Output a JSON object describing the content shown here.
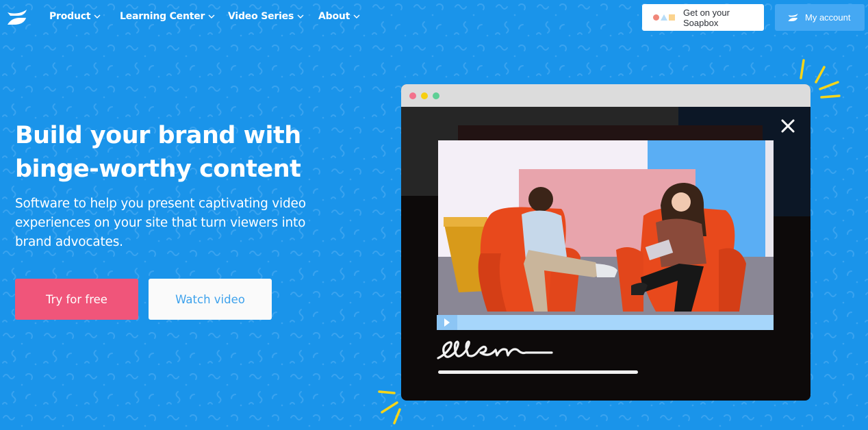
{
  "nav": {
    "logo": "wistia-logo-icon",
    "items": [
      {
        "label": "Product",
        "icon": "chevron-down-icon"
      },
      {
        "label": "Learning Center",
        "icon": "chevron-down-icon"
      },
      {
        "label": "Video Series",
        "icon": "chevron-down-icon"
      },
      {
        "label": "About",
        "icon": "chevron-down-icon"
      }
    ],
    "soapbox_button": {
      "label": "Get on your Soapbox",
      "icon": "soapbox-shapes-icon"
    },
    "account_button": {
      "label": "My account",
      "icon": "wistia-logo-icon"
    }
  },
  "hero": {
    "title_line1": "Build your brand with",
    "title_line2": "binge-worthy content",
    "subtitle": "Software to help you present captivating video experiences on your site that turn viewers into brand advocates.",
    "primary_button": "Try for free",
    "secondary_button": "Watch video"
  },
  "video_preview": {
    "window_controls": [
      "red",
      "yellow",
      "green"
    ],
    "close_icon": "close-icon",
    "play_icon": "play-icon",
    "signature_icon": "signature-scribble-icon",
    "progress": 0.06
  },
  "colors": {
    "background": "#1a94ea",
    "primary_button": "#f0557a",
    "secondary_text": "#3ea2ec",
    "account_button": "#45a8f3",
    "accent_yellow": "#f7d518"
  }
}
